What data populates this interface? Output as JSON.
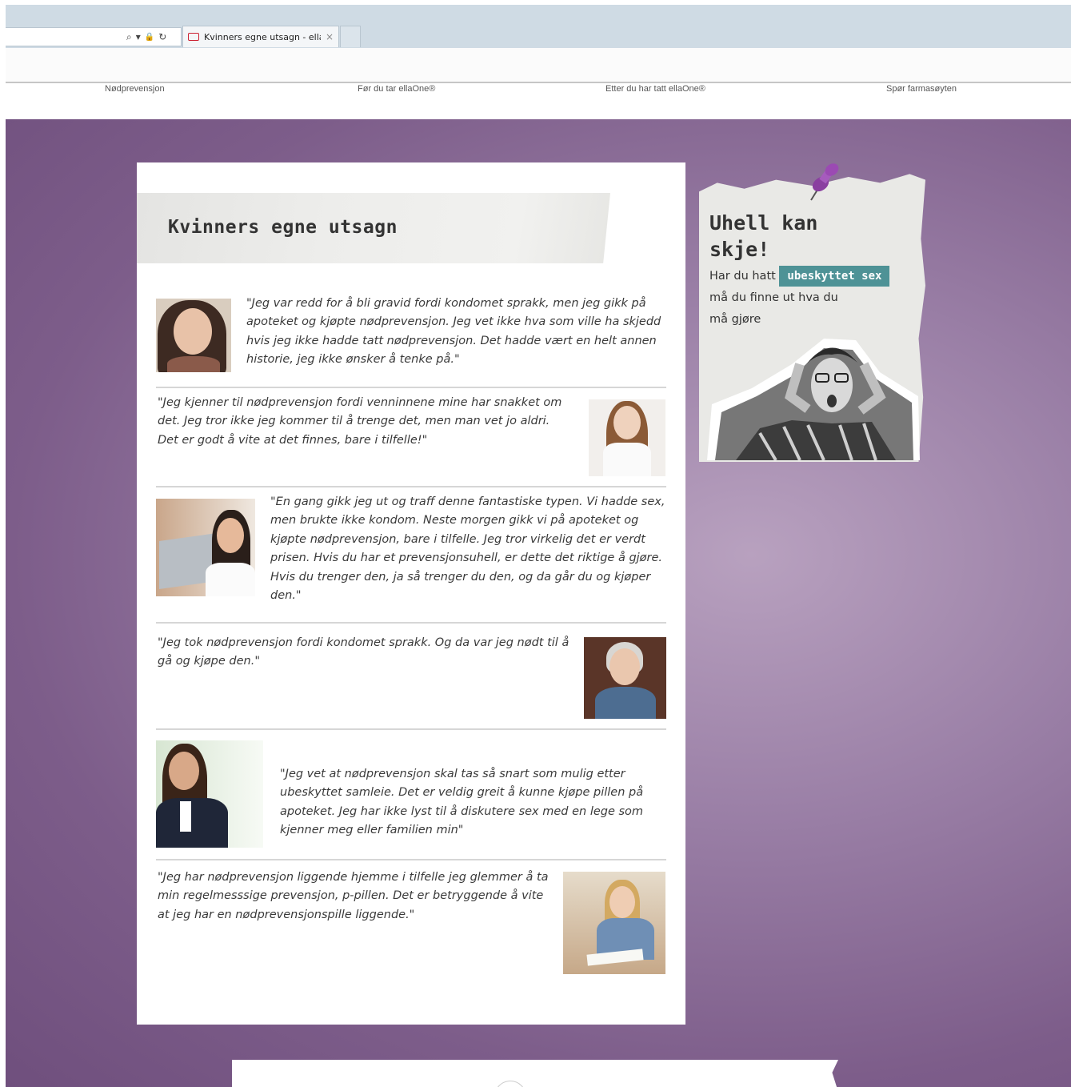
{
  "browser": {
    "tab_title": "Kvinners egne utsagn - ella...",
    "tab_close": "×",
    "address_icons": [
      "⌕",
      "▾",
      "🔒",
      "↻"
    ]
  },
  "nav": {
    "items": [
      {
        "label": "Nødprevensjon"
      },
      {
        "label": "Før du tar ellaOne®"
      },
      {
        "label": "Etter du har tatt ellaOne®"
      },
      {
        "label": "Spør farmasøyten"
      }
    ]
  },
  "card": {
    "title": "Kvinners egne utsagn",
    "testimonials": [
      {
        "quote": "\"Jeg var redd for å bli gravid fordi kondomet sprakk, men jeg gikk på apoteket og kjøpte nødprevensjon. Jeg vet ikke hva som ville ha skjedd hvis jeg ikke hadde tatt nødprevensjon. Det hadde vært en helt annen historie, jeg ikke ønsker å tenke på.\""
      },
      {
        "quote": "\"Jeg kjenner til nødprevensjon fordi venninnene mine har snakket om det.  Jeg tror ikke jeg kommer til å trenge det, men man vet jo aldri. Det er godt å vite at det finnes, bare i tilfelle!\""
      },
      {
        "quote": "\"En gang gikk jeg ut og traff denne fantastiske typen. Vi hadde sex, men brukte ikke kondom. Neste morgen gikk vi på apoteket og kjøpte nødprevensjon, bare i tilfelle. Jeg tror virkelig det er verdt prisen. Hvis du har et prevensjonsuhell, er dette det riktige å gjøre. Hvis du trenger den, ja så trenger du den, og da går du og kjøper den.\""
      },
      {
        "quote": "\"Jeg tok nødprevensjon fordi kondomet sprakk. Og da var jeg nødt til å gå og kjøpe den.\""
      },
      {
        "quote": "\"Jeg vet at nødprevensjon skal tas så snart som mulig etter ubeskyttet samleie. Det er veldig greit å kunne kjøpe pillen på apoteket. Jeg har ikke lyst til å diskutere sex med en lege som kjenner meg eller familien min\""
      },
      {
        "quote": "\"Jeg har nødprevensjon liggende hjemme i tilfelle jeg glemmer å ta min regelmesssige prevensjon, p-pillen. Det er betryggende å vite at jeg har en nødprevensjonspille liggende.\""
      }
    ]
  },
  "sidebar": {
    "title": "Uhell kan skje!",
    "text_before": "Har du hatt",
    "highlight": "ubeskyttet sex",
    "text_after": "må du finne ut hva du må gjøre",
    "accent_color": "#4e9296"
  },
  "colors": {
    "background_purple": "#8a6d97",
    "card": "#ffffff"
  }
}
